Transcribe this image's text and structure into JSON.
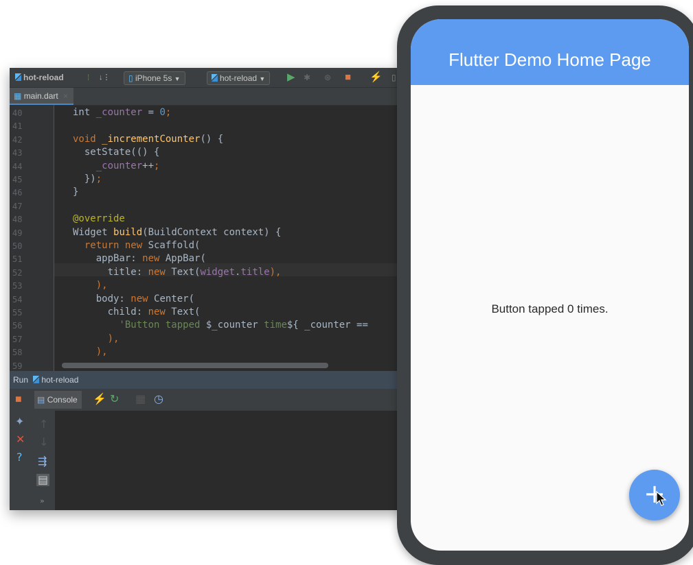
{
  "ide": {
    "toolbar": {
      "project": "hot-reload",
      "device": "iPhone 5s",
      "run_config": "hot-reload"
    },
    "tab": {
      "file": "main.dart"
    },
    "code": {
      "line_numbers": [
        "40",
        "41",
        "42",
        "43",
        "44",
        "45",
        "46",
        "47",
        "48",
        "49",
        "50",
        "51",
        "52",
        "53",
        "54",
        "55",
        "56",
        "57",
        "58",
        "59"
      ],
      "lines": [
        [
          {
            "t": "int ",
            "c": ""
          },
          {
            "t": "_counter",
            "c": "fld"
          },
          {
            "t": " = ",
            "c": ""
          },
          {
            "t": "0",
            "c": "num"
          },
          {
            "t": ";",
            "c": "kw"
          }
        ],
        [],
        [
          {
            "t": "void ",
            "c": "kw"
          },
          {
            "t": "_incrementCounter",
            "c": "fn"
          },
          {
            "t": "() {",
            "c": ""
          }
        ],
        [
          {
            "t": "  setState(() {",
            "c": ""
          }
        ],
        [
          {
            "t": "    ",
            "c": ""
          },
          {
            "t": "_counter",
            "c": "fld"
          },
          {
            "t": "++",
            "c": ""
          },
          {
            "t": ";",
            "c": "kw"
          }
        ],
        [
          {
            "t": "  })",
            "c": ""
          },
          {
            "t": ";",
            "c": "kw"
          }
        ],
        [
          {
            "t": "}",
            "c": ""
          }
        ],
        [],
        [
          {
            "t": "@override",
            "c": "ann"
          }
        ],
        [
          {
            "t": "Widget ",
            "c": ""
          },
          {
            "t": "build",
            "c": "fn"
          },
          {
            "t": "(BuildContext context) {",
            "c": ""
          }
        ],
        [
          {
            "t": "  return new ",
            "c": "kw"
          },
          {
            "t": "Scaffold(",
            "c": ""
          }
        ],
        [
          {
            "t": "    appBar: ",
            "c": ""
          },
          {
            "t": "new ",
            "c": "kw"
          },
          {
            "t": "AppBar(",
            "c": ""
          }
        ],
        [
          {
            "t": "      title: ",
            "c": ""
          },
          {
            "t": "new ",
            "c": "kw"
          },
          {
            "t": "Text(",
            "c": ""
          },
          {
            "t": "widget",
            "c": "fld"
          },
          {
            "t": ".",
            "c": ""
          },
          {
            "t": "title",
            "c": "fld"
          },
          {
            "t": "),",
            "c": "kw"
          }
        ],
        [
          {
            "t": "    ),",
            "c": "kw"
          }
        ],
        [
          {
            "t": "    body: ",
            "c": ""
          },
          {
            "t": "new ",
            "c": "kw"
          },
          {
            "t": "Center(",
            "c": ""
          }
        ],
        [
          {
            "t": "      child: ",
            "c": ""
          },
          {
            "t": "new ",
            "c": "kw"
          },
          {
            "t": "Text(",
            "c": ""
          }
        ],
        [
          {
            "t": "        'Button tapped ",
            "c": "str"
          },
          {
            "t": "$_counter",
            "c": ""
          },
          {
            "t": " time",
            "c": "str"
          },
          {
            "t": "${ _counter ==",
            "c": ""
          }
        ],
        [
          {
            "t": "      ),",
            "c": "kw"
          }
        ],
        [
          {
            "t": "    ),",
            "c": "kw"
          }
        ],
        []
      ]
    },
    "run": {
      "label": "Run",
      "config": "hot-reload",
      "console_tab": "Console"
    }
  },
  "phone": {
    "app_bar_title": "Flutter Demo Home Page",
    "body_text": "Button tapped 0 times.",
    "fab_icon": "+"
  },
  "colors": {
    "app_bar": "#5c9bef",
    "fab": "#5c9bef",
    "ide_bg": "#2b2b2b"
  }
}
